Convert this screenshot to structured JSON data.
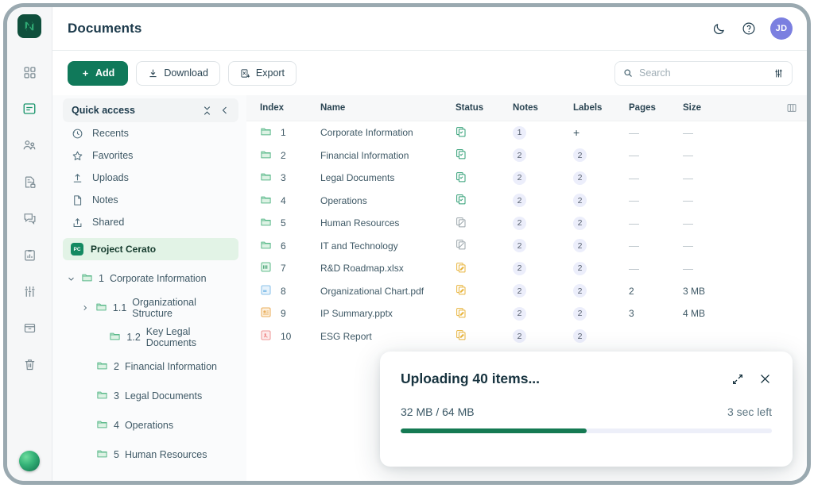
{
  "rail": {
    "logo_name": "app-logo",
    "items": [
      {
        "name": "dashboard-icon",
        "label": "Dashboard",
        "active": false
      },
      {
        "name": "documents-icon",
        "label": "Documents",
        "active": true
      },
      {
        "name": "people-icon",
        "label": "People",
        "active": false
      },
      {
        "name": "document-lock-icon",
        "label": "Secure documents",
        "active": false
      },
      {
        "name": "comments-icon",
        "label": "Comments",
        "active": false
      },
      {
        "name": "reports-icon",
        "label": "Reports",
        "active": false
      },
      {
        "name": "settings-sliders-icon",
        "label": "Settings",
        "active": false
      },
      {
        "name": "archive-icon",
        "label": "Archive",
        "active": false
      },
      {
        "name": "trash-icon",
        "label": "Trash",
        "active": false
      }
    ],
    "orb_name": "assistant-orb"
  },
  "header": {
    "title": "Documents",
    "dark_mode_icon": "moon-icon",
    "help_icon": "help-icon",
    "avatar_initials": "JD",
    "avatar_color": "#7b7fe0"
  },
  "toolbar": {
    "add_label": "Add",
    "download_label": "Download",
    "export_label": "Export",
    "accent_color": "#10795a"
  },
  "search": {
    "placeholder": "Search",
    "value": "",
    "search_icon": "search-icon",
    "filter_icon": "filter-sliders-icon"
  },
  "quick_access": {
    "title": "Quick access",
    "collapse_all_icon": "collapse-all-icon",
    "collapse_panel_icon": "chevron-left-icon",
    "items": [
      {
        "icon": "clock-icon",
        "label": "Recents"
      },
      {
        "icon": "star-icon",
        "label": "Favorites"
      },
      {
        "icon": "upload-icon",
        "label": "Uploads"
      },
      {
        "icon": "note-icon",
        "label": "Notes"
      },
      {
        "icon": "share-icon",
        "label": "Shared"
      }
    ]
  },
  "project": {
    "badge": "PC",
    "name": "Project Cerato",
    "badge_color": "#148a62",
    "row_background": "#e2f3e6"
  },
  "tree": [
    {
      "level": 0,
      "twisty": "expanded",
      "num": "1",
      "label": "Corporate Information"
    },
    {
      "level": 1,
      "twisty": "collapsed",
      "num": "1.1",
      "label": "Organizational Structure"
    },
    {
      "level": 2,
      "twisty": "none",
      "num": "1.2",
      "label": "Key Legal Documents"
    },
    {
      "level": 0,
      "twisty": "none",
      "num": "2",
      "label": "Financial Information"
    },
    {
      "level": 0,
      "twisty": "none",
      "num": "3",
      "label": "Legal Documents"
    },
    {
      "level": 0,
      "twisty": "none",
      "num": "4",
      "label": "Operations"
    },
    {
      "level": 0,
      "twisty": "none",
      "num": "5",
      "label": "Human Resources"
    }
  ],
  "table": {
    "columns": [
      "Index",
      "Name",
      "Status",
      "Notes",
      "Labels",
      "Pages",
      "Size"
    ],
    "columns_settings_icon": "columns-settings-icon",
    "rows": [
      {
        "index": "1",
        "name": "Corporate Information",
        "file_icon": "folder-icon",
        "status_icon": "copy-check-icon",
        "status_color": "green",
        "notes": "1",
        "labels": "+",
        "pages": "—",
        "size": "—"
      },
      {
        "index": "2",
        "name": "Financial Information",
        "file_icon": "folder-icon",
        "status_icon": "copy-check-icon",
        "status_color": "green",
        "notes": "2",
        "labels": "2",
        "pages": "—",
        "size": "—"
      },
      {
        "index": "3",
        "name": "Legal Documents",
        "file_icon": "folder-icon",
        "status_icon": "copy-check-icon",
        "status_color": "green",
        "notes": "2",
        "labels": "2",
        "pages": "—",
        "size": "—"
      },
      {
        "index": "4",
        "name": "Operations",
        "file_icon": "folder-icon",
        "status_icon": "copy-check-icon",
        "status_color": "green",
        "notes": "2",
        "labels": "2",
        "pages": "—",
        "size": "—"
      },
      {
        "index": "5",
        "name": "Human Resources",
        "file_icon": "folder-icon",
        "status_icon": "copy-blocked-icon",
        "status_color": "gray",
        "notes": "2",
        "labels": "2",
        "pages": "—",
        "size": "—"
      },
      {
        "index": "6",
        "name": "IT and Technology",
        "file_icon": "folder-icon",
        "status_icon": "copy-blocked-icon",
        "status_color": "gray",
        "notes": "2",
        "labels": "2",
        "pages": "—",
        "size": "—"
      },
      {
        "index": "7",
        "name": "R&D Roadmap.xlsx",
        "file_icon": "excel-file-icon",
        "status_icon": "copy-pending-icon",
        "status_color": "yellow",
        "notes": "2",
        "labels": "2",
        "pages": "—",
        "size": "—"
      },
      {
        "index": "8",
        "name": "Organizational Chart.pdf",
        "file_icon": "doc-file-icon",
        "status_icon": "copy-pending-icon",
        "status_color": "yellow",
        "notes": "2",
        "labels": "2",
        "pages": "2",
        "size": "3 MB"
      },
      {
        "index": "9",
        "name": "IP Summary.pptx",
        "file_icon": "ppt-file-icon",
        "status_icon": "copy-pending-icon",
        "status_color": "yellow",
        "notes": "2",
        "labels": "2",
        "pages": "3",
        "size": "4 MB"
      },
      {
        "index": "10",
        "name": "ESG Report",
        "file_icon": "pdf-file-icon",
        "status_icon": "copy-pending-icon",
        "status_color": "yellow",
        "notes": "2",
        "labels": "2",
        "pages": "",
        "size": ""
      }
    ]
  },
  "upload_modal": {
    "title": "Uploading 40 items...",
    "progress_text": "32 MB / 64 MB",
    "eta_text": "3 sec left",
    "progress_percent": 50,
    "bar_color": "#157a53",
    "expand_icon": "expand-icon",
    "close_icon": "close-icon"
  }
}
